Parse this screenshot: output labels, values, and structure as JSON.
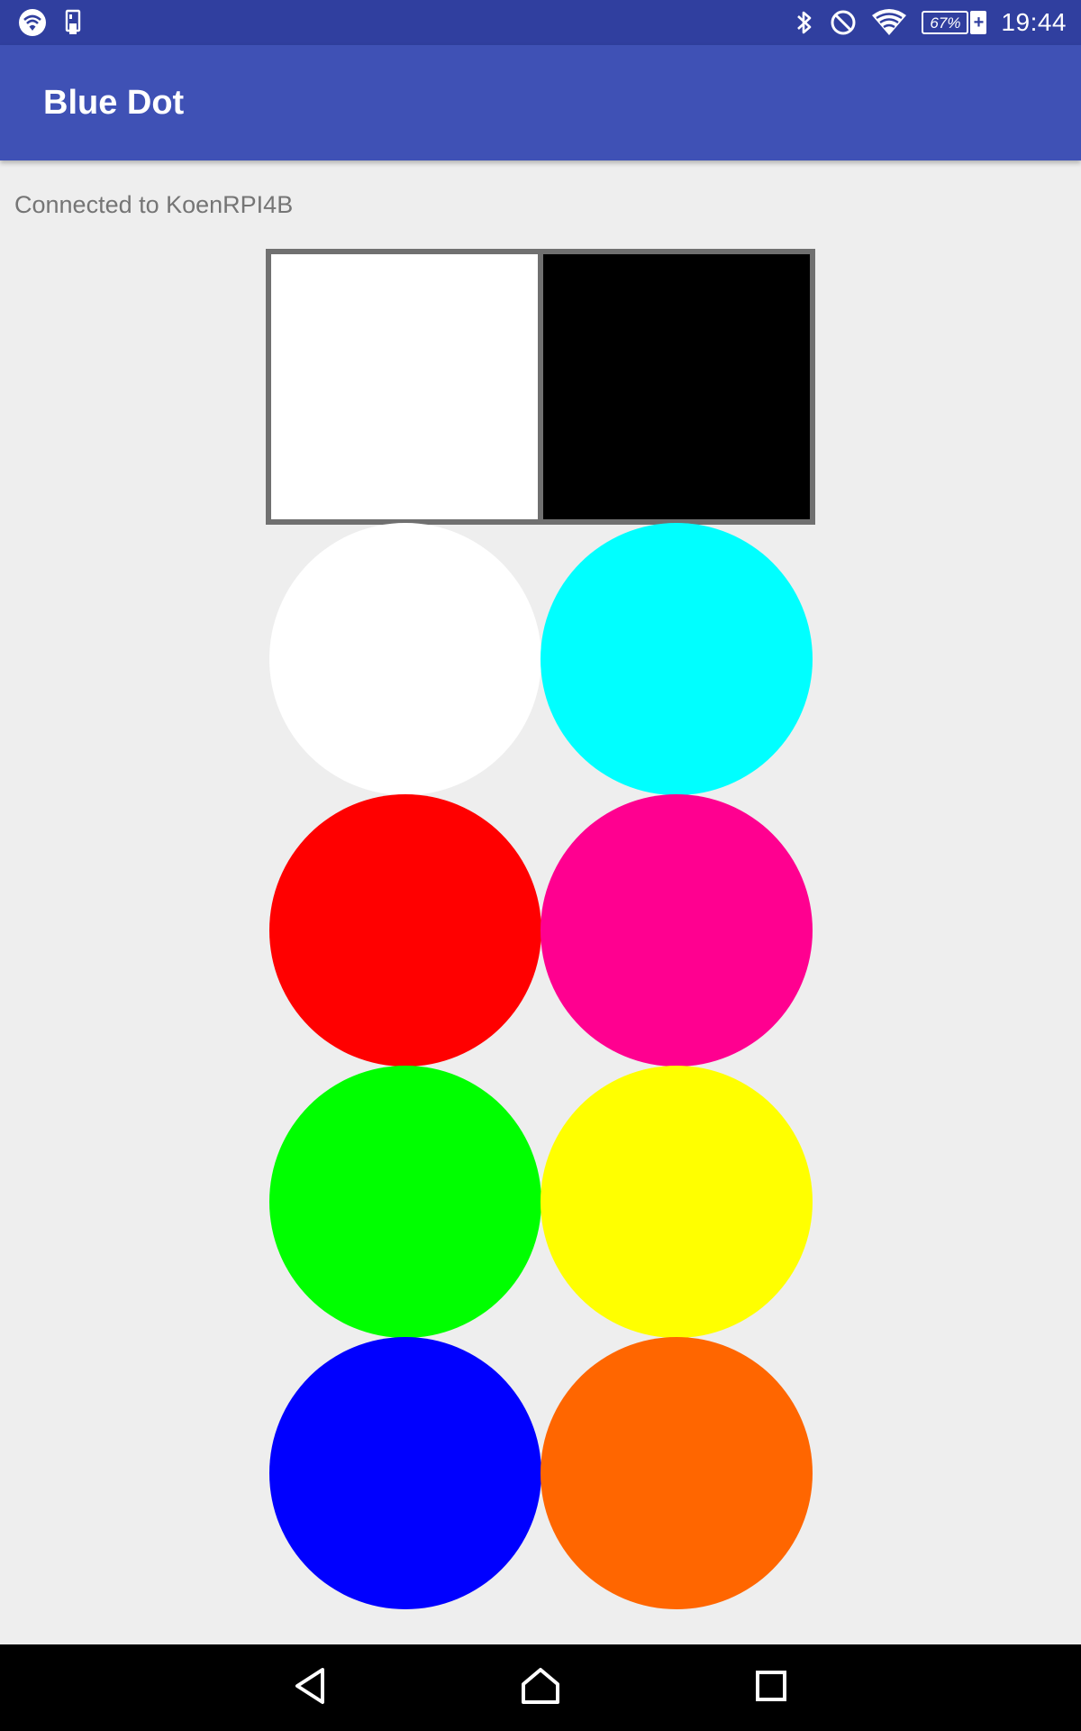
{
  "status_bar": {
    "time": "19:44",
    "battery_percent": "67%",
    "battery_charging_symbol": "+",
    "icons_left": [
      "wifi-hotspot-icon",
      "sim-card-icon"
    ],
    "icons_right": [
      "bluetooth-icon",
      "do-not-disturb-icon",
      "wifi-icon",
      "battery-icon"
    ]
  },
  "app_bar": {
    "title": "Blue Dot"
  },
  "main": {
    "connection_status": "Connected to KoenRPI4B",
    "swatches": [
      {
        "name": "white",
        "color": "#ffffff"
      },
      {
        "name": "black",
        "color": "#000000"
      }
    ],
    "dots": [
      {
        "name": "white",
        "color": "#ffffff"
      },
      {
        "name": "cyan",
        "color": "#00ffff"
      },
      {
        "name": "red",
        "color": "#ff0000"
      },
      {
        "name": "magenta",
        "color": "#ff0090"
      },
      {
        "name": "green",
        "color": "#00ff00"
      },
      {
        "name": "yellow",
        "color": "#ffff00"
      },
      {
        "name": "blue",
        "color": "#0000ff"
      },
      {
        "name": "orange",
        "color": "#ff6600"
      }
    ]
  },
  "nav_bar": {
    "buttons": [
      "back-icon",
      "home-icon",
      "recents-icon"
    ]
  },
  "colors": {
    "status_bar": "#303f9f",
    "app_bar": "#3f51b5",
    "background": "#eeeeee",
    "swatch_border": "#707070"
  }
}
